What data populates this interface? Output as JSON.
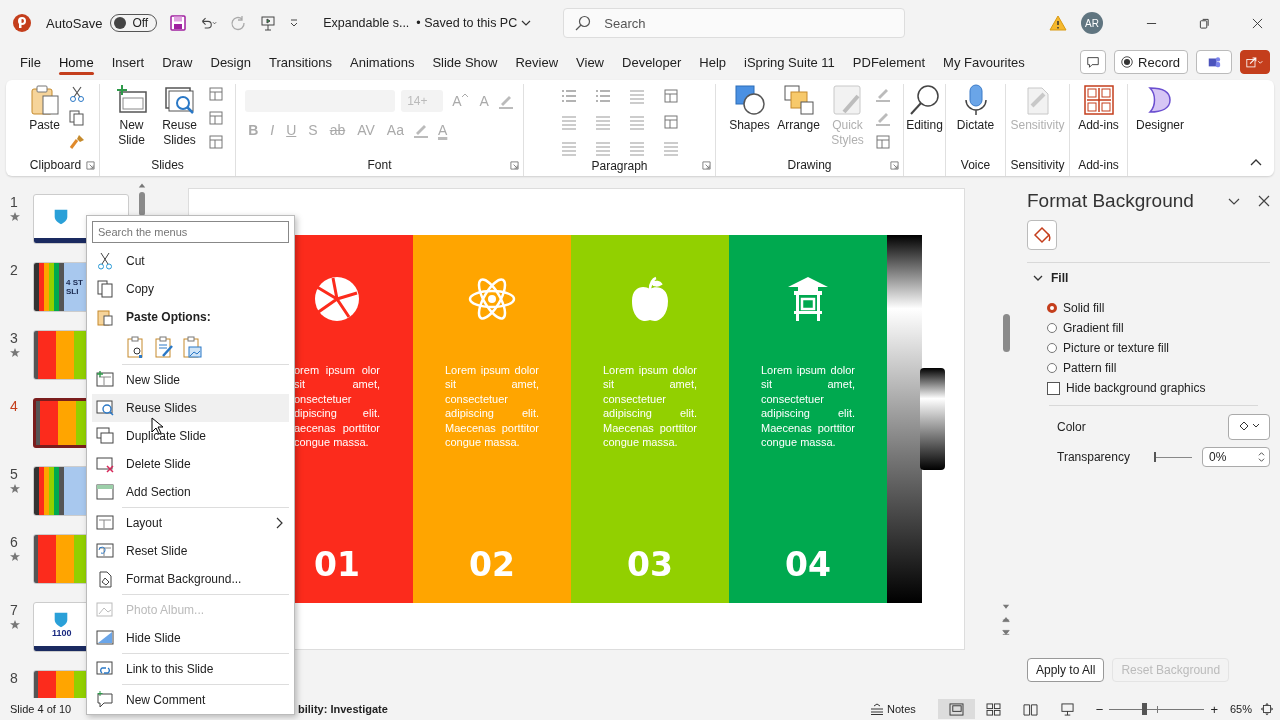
{
  "title_bar": {
    "autosave_label": "AutoSave",
    "autosave": {
      "label": "Off",
      "on": false
    },
    "document_title": "Expandable s...",
    "save_status": "• Saved to this PC",
    "search": {
      "placeholder": "Search"
    },
    "avatar": "AR"
  },
  "ribbon_tabs": [
    {
      "label": "File",
      "selected": false
    },
    {
      "label": "Home",
      "selected": true
    },
    {
      "label": "Insert",
      "selected": false
    },
    {
      "label": "Draw",
      "selected": false
    },
    {
      "label": "Design",
      "selected": false
    },
    {
      "label": "Transitions",
      "selected": false
    },
    {
      "label": "Animations",
      "selected": false
    },
    {
      "label": "Slide Show",
      "selected": false
    },
    {
      "label": "Review",
      "selected": false
    },
    {
      "label": "View",
      "selected": false
    },
    {
      "label": "Developer",
      "selected": false
    },
    {
      "label": "Help",
      "selected": false
    },
    {
      "label": "iSpring Suite 11",
      "selected": false
    },
    {
      "label": "PDFelement",
      "selected": false
    },
    {
      "label": "My Favourites",
      "selected": false
    }
  ],
  "record_button": "Record",
  "ribbon": {
    "groups": [
      {
        "label": "Clipboard",
        "launcher": true,
        "buttons": [
          {
            "label": "Paste",
            "disabled": false
          }
        ]
      },
      {
        "label": "Slides",
        "launcher": false,
        "buttons": [
          {
            "label": "New Slide",
            "disabled": false
          },
          {
            "label": "Reuse Slides",
            "disabled": false
          }
        ]
      },
      {
        "label": "Font",
        "launcher": true,
        "font_size": "14+",
        "size_keys": [
          "A",
          "A"
        ],
        "format_keys": [
          "B",
          "I",
          "U",
          "S",
          "ab",
          "AV",
          "Aa"
        ],
        "color_key": "A"
      },
      {
        "label": "Paragraph",
        "launcher": true
      },
      {
        "label": "Drawing",
        "launcher": true,
        "buttons": [
          {
            "label": "Shapes",
            "disabled": false
          },
          {
            "label": "Arrange",
            "disabled": false
          },
          {
            "label": "Quick Styles",
            "disabled": true
          }
        ]
      },
      {
        "launcher": false,
        "buttons": [
          {
            "label": "Editing",
            "disabled": false
          }
        ]
      },
      {
        "label": "Voice",
        "launcher": false,
        "buttons": [
          {
            "label": "Dictate",
            "disabled": false
          }
        ]
      },
      {
        "label": "Sensitivity",
        "launcher": false,
        "buttons": [
          {
            "label": "Sensitivity",
            "disabled": true
          }
        ]
      },
      {
        "label": "Add-ins",
        "launcher": false,
        "buttons": [
          {
            "label": "Add-ins",
            "disabled": false
          }
        ]
      },
      {
        "launcher": false,
        "buttons": [
          {
            "label": "Designer",
            "disabled": false
          }
        ]
      }
    ]
  },
  "thumbnails": [
    {
      "number": "1",
      "starred": true,
      "selected": false,
      "kind": "title"
    },
    {
      "number": "2",
      "starred": false,
      "selected": false,
      "kind": "bars",
      "texts": [
        "4 ST",
        "SLI"
      ]
    },
    {
      "number": "3",
      "starred": true,
      "selected": false,
      "kind": "columns"
    },
    {
      "number": "4",
      "starred": false,
      "selected": true,
      "kind": "columns"
    },
    {
      "number": "5",
      "starred": true,
      "selected": false,
      "kind": "bars"
    },
    {
      "number": "6",
      "starred": true,
      "selected": false,
      "kind": "columns"
    },
    {
      "number": "7",
      "starred": true,
      "selected": false,
      "kind": "title",
      "texts": [
        "1100"
      ]
    },
    {
      "number": "8",
      "starred": false,
      "selected": false,
      "kind": "columns"
    }
  ],
  "slide": {
    "columns": [
      {
        "color": "#fc2b1c",
        "text": "orem ipsum olor sit amet, onsectetuer dipiscing elit. aecenas porttitor congue massa.",
        "number": "01"
      },
      {
        "color": "#ffa500",
        "text": "Lorem ipsum dolor sit amet, consectetuer adipiscing elit. Maecenas porttitor congue massa.",
        "number": "02"
      },
      {
        "color": "#92d000",
        "text": "Lorem ipsum dolor sit amet, consectetuer adipiscing elit. Maecenas porttitor congue massa.",
        "number": "03"
      },
      {
        "color": "#00a94f",
        "text": "Lorem ipsum dolor sit amet, consectetuer adipiscing elit. Maecenas porttitor congue massa.",
        "number": "04"
      }
    ]
  },
  "context_menu": {
    "search": {
      "placeholder": "Search the menus"
    },
    "items": [
      {
        "kind": "item",
        "label": "Cut",
        "disabled": false,
        "selected": false
      },
      {
        "kind": "item",
        "label": "Copy",
        "disabled": false,
        "selected": false
      },
      {
        "kind": "heading",
        "label": "Paste Options:"
      },
      {
        "kind": "paste-options"
      },
      {
        "kind": "separator"
      },
      {
        "kind": "item",
        "label": "New Slide",
        "disabled": false,
        "selected": false
      },
      {
        "kind": "item",
        "label": "Reuse Slides",
        "disabled": false,
        "selected": true
      },
      {
        "kind": "item",
        "label": "Duplicate Slide",
        "disabled": false,
        "selected": false
      },
      {
        "kind": "item",
        "label": "Delete Slide",
        "disabled": false,
        "selected": false
      },
      {
        "kind": "item",
        "label": "Add Section",
        "disabled": false,
        "selected": false
      },
      {
        "kind": "separator"
      },
      {
        "kind": "submenu",
        "label": "Layout",
        "disabled": false,
        "selected": false
      },
      {
        "kind": "item",
        "label": "Reset Slide",
        "disabled": false,
        "selected": false
      },
      {
        "kind": "item",
        "label": "Format Background...",
        "disabled": false,
        "selected": false
      },
      {
        "kind": "separator"
      },
      {
        "kind": "item",
        "label": "Photo Album...",
        "disabled": true,
        "selected": false
      },
      {
        "kind": "item",
        "label": "Hide Slide",
        "disabled": false,
        "selected": false
      },
      {
        "kind": "separator"
      },
      {
        "kind": "item",
        "label": "Link to this Slide",
        "disabled": false,
        "selected": false
      },
      {
        "kind": "separator"
      },
      {
        "kind": "item",
        "label": "New Comment",
        "disabled": false,
        "selected": false
      }
    ]
  },
  "format_pane": {
    "title": "Format Background",
    "section": {
      "label": "Fill",
      "expanded": true
    },
    "fill_options": [
      {
        "label": "Solid fill",
        "selected": true
      },
      {
        "label": "Gradient fill",
        "selected": false
      },
      {
        "label": "Picture or texture fill",
        "selected": false
      },
      {
        "label": "Pattern fill",
        "selected": false
      }
    ],
    "hide_graphics": {
      "label": "Hide background graphics",
      "checked": false
    },
    "color_label": "Color",
    "transparency": {
      "label": "Transparency",
      "level": 0,
      "value": "0%"
    },
    "buttons": [
      {
        "label": "Apply to All",
        "disabled": false
      },
      {
        "label": "Reset Background",
        "disabled": true
      }
    ]
  },
  "status_bar": {
    "slide_info": "Slide 4 of 10",
    "accessibility": "bility: Investigate",
    "notes": "Notes",
    "views": [
      {
        "selected": true
      },
      {
        "selected": false
      },
      {
        "selected": false
      },
      {
        "selected": false
      }
    ],
    "zoom": {
      "level": 0.34,
      "value": "65%",
      "minus": "−",
      "plus": "+"
    }
  }
}
